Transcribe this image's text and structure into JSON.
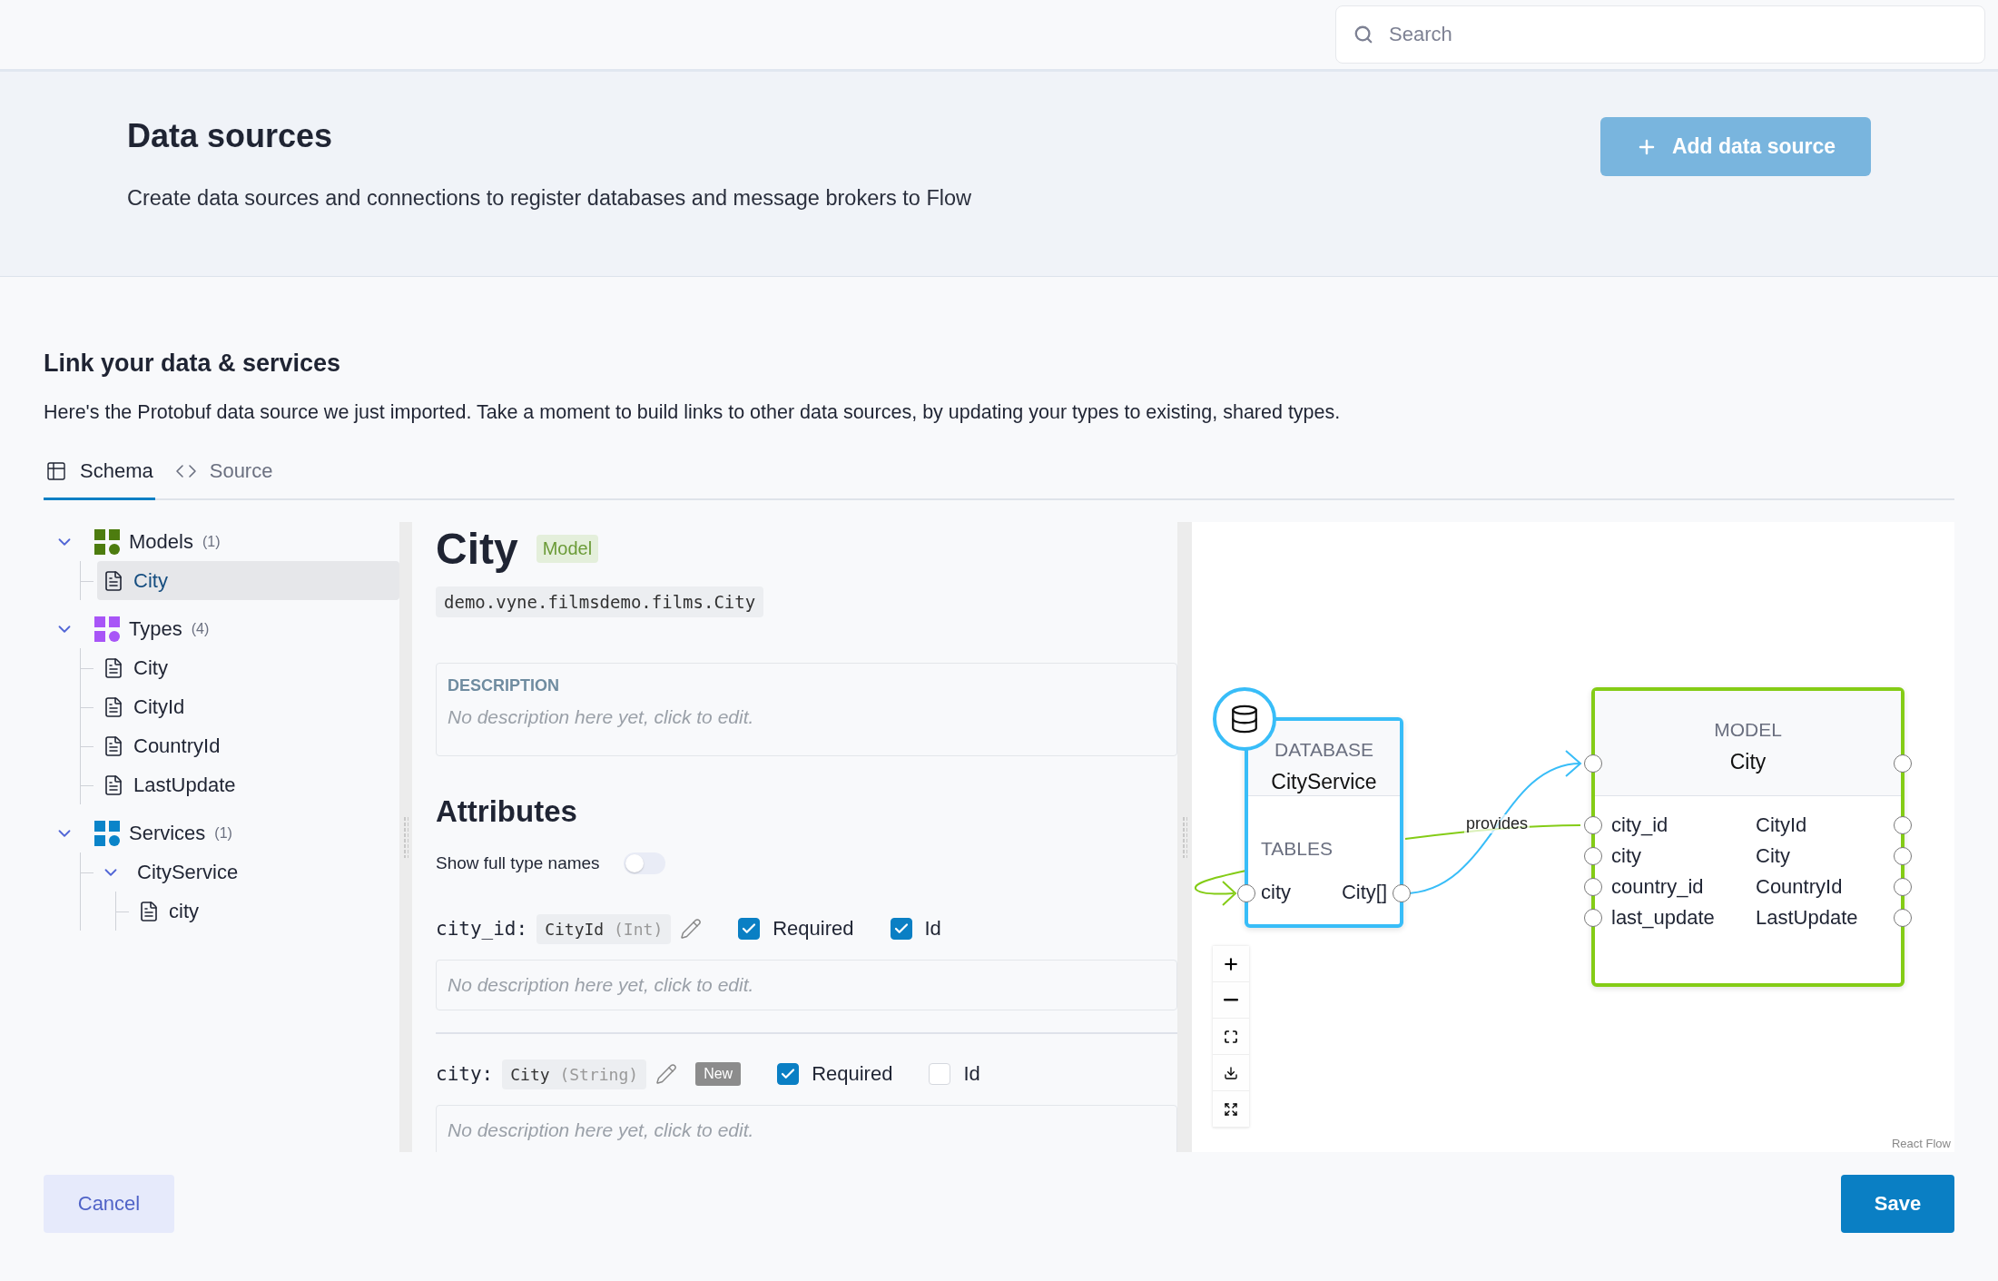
{
  "search": {
    "placeholder": "Search"
  },
  "header": {
    "title": "Data sources",
    "description": "Create data sources and connections to register databases and message brokers to Flow",
    "add_button": "Add data source"
  },
  "section": {
    "title": "Link your data & services",
    "description": "Here's the Protobuf data source we just imported. Take a moment to build links to other data sources, by updating your types to existing, shared types."
  },
  "tabs": [
    {
      "label": "Schema",
      "kind": "schema",
      "selected": true
    },
    {
      "label": "Source",
      "kind": "source",
      "selected": false
    }
  ],
  "tree": [
    {
      "kind": "group",
      "label": "Models",
      "count": "(1)",
      "color": "#4d7c0f",
      "expanded": true,
      "selected": false,
      "children": [
        {
          "kind": "leaf",
          "label": "City",
          "selected": true
        }
      ]
    },
    {
      "kind": "group",
      "label": "Types",
      "count": "(4)",
      "color": "#a855f7",
      "expanded": true,
      "selected": false,
      "children": [
        {
          "kind": "leaf",
          "label": "City",
          "selected": false
        },
        {
          "kind": "leaf",
          "label": "CityId",
          "selected": false
        },
        {
          "kind": "leaf",
          "label": "CountryId",
          "selected": false
        },
        {
          "kind": "leaf",
          "label": "LastUpdate",
          "selected": false
        }
      ]
    },
    {
      "kind": "group",
      "label": "Services",
      "count": "(1)",
      "color": "#0a84c9",
      "expanded": true,
      "selected": false,
      "children": [
        {
          "kind": "service",
          "label": "CityService",
          "expanded": true,
          "selected": false,
          "children": [
            {
              "kind": "leaf",
              "label": "city",
              "selected": false
            }
          ]
        }
      ]
    }
  ],
  "detail": {
    "title": "City",
    "badge": "Model",
    "qualified_name": "demo.vyne.filmsdemo.films.City",
    "description_label": "DESCRIPTION",
    "description_placeholder": "No description here yet, click to edit.",
    "attributes_title": "Attributes",
    "toggle": {
      "label": "Show full type names",
      "on": false
    },
    "attributes": [
      {
        "name": "city_id:",
        "type": "CityId",
        "primitive": "(Int)",
        "required": true,
        "required_label": "Required",
        "id": true,
        "id_label": "Id",
        "placeholder": "No description here yet, click to edit."
      },
      {
        "name": "city:",
        "type": "City",
        "primitive": "(String)",
        "badge": "New",
        "required": true,
        "required_label": "Required",
        "id": false,
        "id_label": "Id",
        "placeholder": "No description here yet, click to edit."
      }
    ]
  },
  "diagram": {
    "database": {
      "kind_label": "DATABASE",
      "name": "CityService",
      "section": "TABLES",
      "rows": [
        {
          "name": "city",
          "type": "City[]"
        }
      ]
    },
    "model": {
      "kind_label": "MODEL",
      "name": "City",
      "fields": [
        {
          "name": "city_id",
          "type": "CityId"
        },
        {
          "name": "city",
          "type": "City"
        },
        {
          "name": "country_id",
          "type": "CountryId"
        },
        {
          "name": "last_update",
          "type": "LastUpdate"
        }
      ]
    },
    "edge_label": "provides",
    "attribution": "React Flow"
  },
  "footer": {
    "cancel": "Cancel",
    "save": "Save"
  }
}
